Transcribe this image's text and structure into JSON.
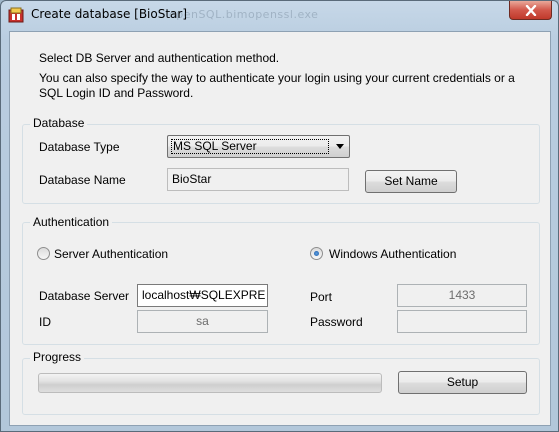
{
  "window": {
    "title": "Create database [BioStar]",
    "background_title": "openSQL.bimopenssl.exe"
  },
  "intro": {
    "line1": "Select DB Server and authentication method.",
    "line2": "You can also specify the way to authenticate your login using your current credentials or a",
    "line3": "SQL Login ID and Password."
  },
  "database": {
    "group_title": "Database",
    "type_label": "Database Type",
    "type_value": "MS SQL Server",
    "name_label": "Database Name",
    "name_value": "BioStar",
    "set_name_button": "Set Name"
  },
  "authentication": {
    "group_title": "Authentication",
    "server_auth_label": "Server Authentication",
    "windows_auth_label": "Windows Authentication",
    "selected": "Windows Authentication",
    "server_label": "Database Server",
    "server_value": "localhost₩SQLEXPRE",
    "port_label": "Port",
    "port_value": "1433",
    "id_label": "ID",
    "id_value": "sa",
    "password_label": "Password",
    "password_value": ""
  },
  "progress": {
    "group_title": "Progress",
    "setup_button": "Setup"
  },
  "colors": {
    "title_frame": "#b9cde0",
    "client_bg": "#f0f0f0",
    "close_button": "#c0392b"
  }
}
